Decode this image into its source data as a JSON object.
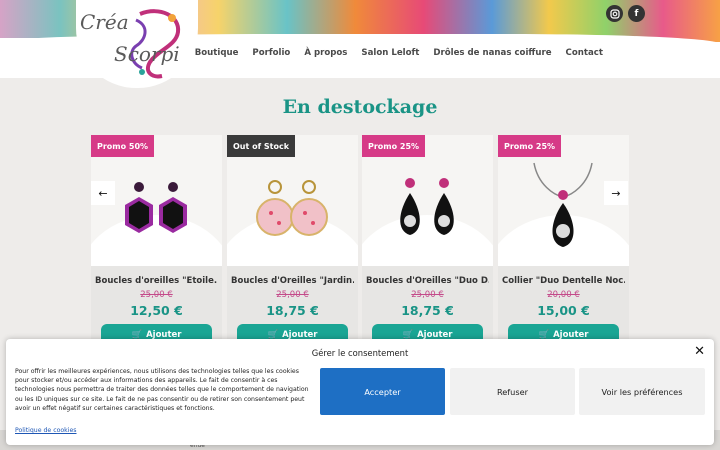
{
  "brand": {
    "line1": "Créa",
    "line2": "Scorpi"
  },
  "nav": [
    {
      "label": "Boutique"
    },
    {
      "label": "Porfolio"
    },
    {
      "label": "À propos"
    },
    {
      "label": "Salon Leloft"
    },
    {
      "label": "Drôles de nanas coiffure"
    },
    {
      "label": "Contact"
    }
  ],
  "social": {
    "instagram": "instagram-icon",
    "facebook": "facebook-icon"
  },
  "section": {
    "title": "En destockage"
  },
  "products": [
    {
      "badge": "Promo 50%",
      "name": "Boucles d'oreilles \"Étoile...",
      "old_price": "25,00 €",
      "price": "12,50 €",
      "button": "Ajouter",
      "color": "#8a2a8a"
    },
    {
      "badge": "Out of Stock",
      "name": "Boucles d'Oreilles \"Jardin...",
      "old_price": "25,00 €",
      "price": "18,75 €",
      "button": "Ajouter",
      "color": "#e8b7c3"
    },
    {
      "badge": "Promo 25%",
      "name": "Boucles d'Oreilles \"Duo D...",
      "old_price": "25,00 €",
      "price": "18,75 €",
      "button": "Ajouter",
      "color": "#1b1b1b"
    },
    {
      "badge": "Promo 25%",
      "name": "Collier \"Duo Dentelle Noc...",
      "old_price": "20,00 €",
      "price": "15,00 €",
      "button": "Ajouter",
      "color": "#1b1b1b"
    }
  ],
  "carousel": {
    "prev": "←",
    "next": "→"
  },
  "footer_peek": {
    "word": "enue"
  },
  "consent": {
    "title": "Gérer le consentement",
    "close": "✕",
    "text": "Pour offrir les meilleures expériences, nous utilisons des technologies telles que les cookies pour stocker et/ou accéder aux informations des appareils. Le fait de consentir à ces technologies nous permettra de traiter des données telles que le comportement de navigation ou les ID uniques sur ce site. Le fait de ne pas consentir ou de retirer son consentement peut avoir un effet négatif sur certaines caractéristiques et fonctions.",
    "link": "Politique de cookies",
    "accept": "Accepter",
    "refuse": "Refuser",
    "preferences": "Voir les préférences"
  }
}
